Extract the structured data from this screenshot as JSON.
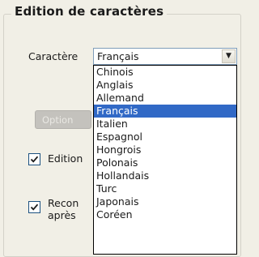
{
  "group": {
    "title": "Edition de caractères"
  },
  "charset": {
    "label": "Caractère",
    "selected": "Français",
    "options": [
      "Chinois",
      "Anglais",
      "Allemand",
      "Français",
      "Italien",
      "Espagnol",
      "Hongrois",
      "Polonais",
      "Hollandais",
      "Turc",
      "Japonais",
      "Coréen"
    ],
    "selected_index": 3
  },
  "options_button": {
    "label": "Option"
  },
  "checkboxes": [
    {
      "label": "Edition",
      "checked": true
    },
    {
      "label": "Recon",
      "sub_label": "après",
      "checked": true
    }
  ],
  "colors": {
    "selection": "#3169c6",
    "window_bg": "#f1efe6"
  }
}
